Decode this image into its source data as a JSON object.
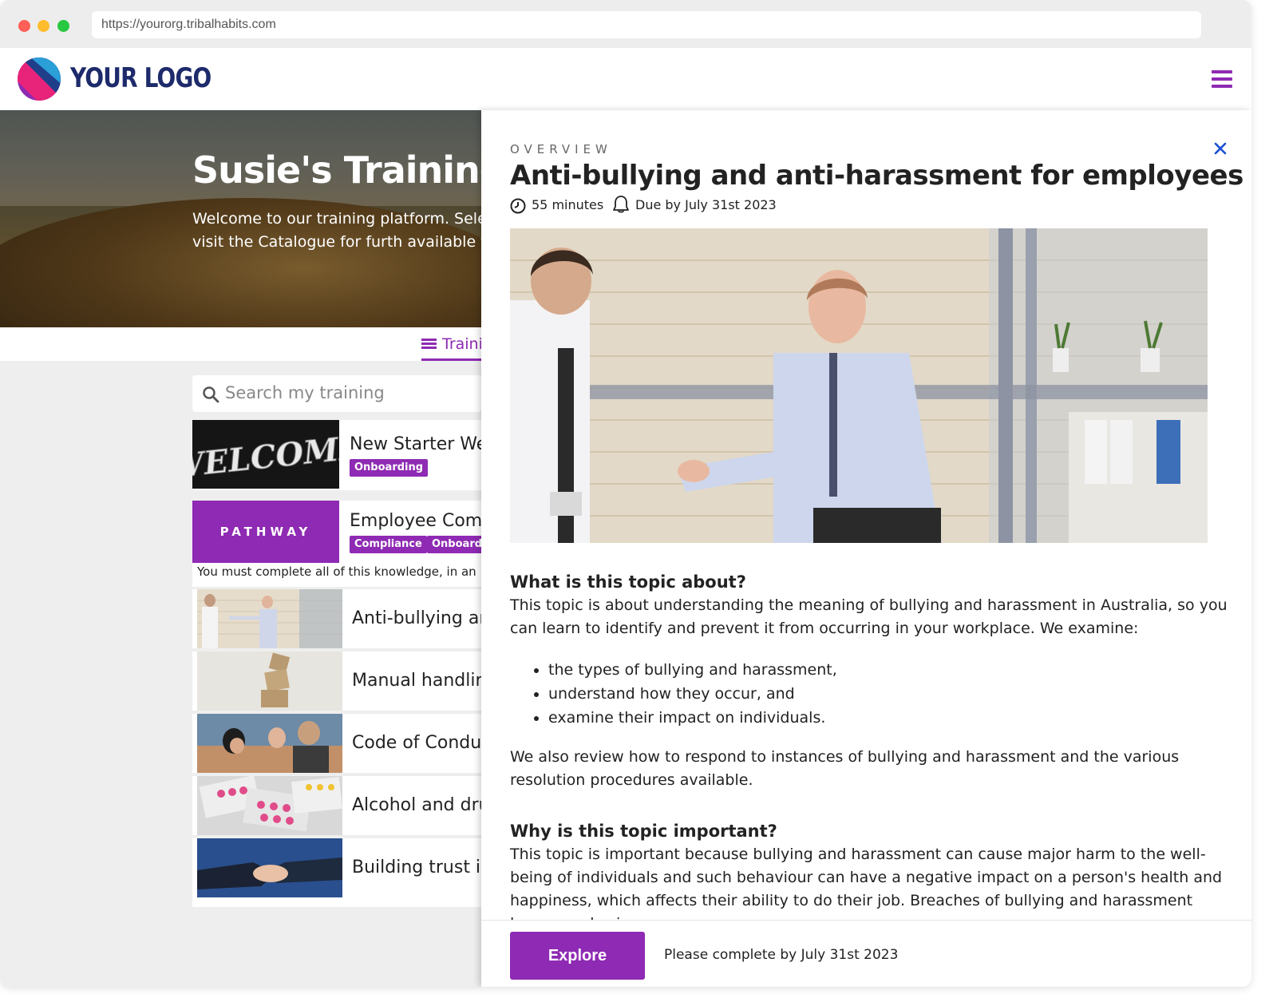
{
  "browser": {
    "url": "https://yourorg.tribalhabits.com"
  },
  "header": {
    "logo_text": "YOUR LOGO",
    "menu_icon": "hamburger-menu-icon",
    "accent_color": "#8e2ab3"
  },
  "hero": {
    "title": "Susie's Training",
    "text": "Welcome to our training platform. Select exploring or visit the Catalogue for furth available to you."
  },
  "tabs": {
    "training_label": "Traini"
  },
  "search": {
    "placeholder": "Search my training"
  },
  "training_list": [
    {
      "title": "New Starter Wel",
      "badges": [
        "Onboarding"
      ],
      "thumb_text": "WELCOME"
    },
    {
      "title": "Employee Comp",
      "badges": [
        "Compliance",
        "Onboardi"
      ],
      "thumb_text": "PATHWAY",
      "note": "You must complete all of this knowledge, in an"
    },
    {
      "title": "Anti-bullying anc"
    },
    {
      "title": "Manual handling"
    },
    {
      "title": "Code of Conduc"
    },
    {
      "title": "Alcohol and dru"
    },
    {
      "title": "Building trust in"
    }
  ],
  "panel": {
    "overview_label": "OVERVIEW",
    "title": "Anti-bullying and anti-harassment for employees (AU)",
    "duration": "55 minutes",
    "due": "Due by July 31st 2023",
    "sections": {
      "about_heading": "What is this topic about?",
      "about_text": "This topic is about understanding the meaning of bullying and harassment in Australia, so you can learn to identify and prevent it from occurring in your workplace. We examine:",
      "bullets": [
        "the types of bullying and harassment,",
        "understand how they occur, and",
        "examine their impact on individuals."
      ],
      "review_text": "We also review how to respond to instances of bullying and harassment and the various resolution procedures available.",
      "important_heading": "Why is this topic important?",
      "important_text": "This topic is important because bullying and harassment can cause major harm to the well-being of individuals and such behaviour can have a negative impact on a person's health and happiness, which affects their ability to do their job. Breaches of bullying and harassment laws can also incur"
    },
    "footer": {
      "button_label": "Explore",
      "note": "Please complete by July 31st 2023"
    }
  }
}
